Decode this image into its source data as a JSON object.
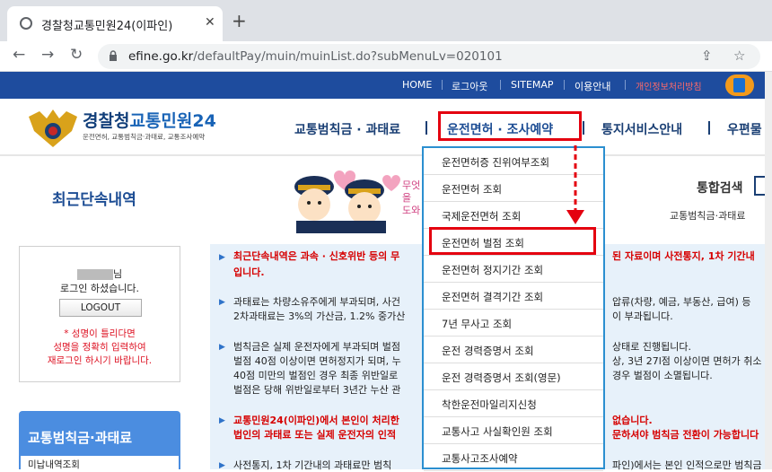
{
  "browser": {
    "tab_title": "경찰청교통민원24(이파인)",
    "url_host": "efine.go.kr",
    "url_path": "/defaultPay/muin/muinList.do?subMenuLv=020101"
  },
  "topbar": {
    "items": [
      "HOME",
      "로그아웃",
      "SITEMAP",
      "이용안내",
      "개인정보처리방침"
    ]
  },
  "header": {
    "logo_a": "경찰청",
    "logo_b": "교통민원24",
    "logo_sub": "운전면허, 교통범칙금·과태료, 교통조사예약",
    "gnb": [
      "교통범칙금 · 과태료",
      "운전면허 · 조사예약",
      "통지서비스안내",
      "우편물"
    ]
  },
  "page": {
    "title": "최근단속내역",
    "search_label": "통합검색",
    "search_sub": "교통범칙금·과태료",
    "mascot_text": "무엇을 도와"
  },
  "login": {
    "user_suffix": "님",
    "status": "로그인 하셨습니다.",
    "logout_label": "LOGOUT",
    "warning": [
      "* 성명이 틀리다면",
      "성명을 정확히 입력하여",
      "재로그인 하시기 바랍니다."
    ]
  },
  "left_menu": {
    "title": "교통범칙금·과태료",
    "sub_item": "미납내역조회"
  },
  "notice": {
    "lines": [
      {
        "text": "최근단속내역은 과속 · 신호위반 등의 무",
        "red": true
      },
      {
        "text": "입니다.",
        "red": true
      },
      {
        "text": "과태료는 차량소유주에게 부과되며, 사건",
        "red": false
      },
      {
        "text": "2차과태료는 3%의 가산금, 1.2% 중가산",
        "red": false
      },
      {
        "text": "범칙금은 실제 운전자에게 부과되며 벌점",
        "red": false
      },
      {
        "text": "벌점 40점 이상이면 면허정지가 되며, 누",
        "red": false
      },
      {
        "text": "40점 미만의 벌점인 경우 최종 위반일로",
        "red": false
      },
      {
        "text": "벌점은 당해 위반일로부터 3년간 누산 관",
        "red": false
      },
      {
        "text": "교통민원24(이파인)에서 본인이 처리한",
        "red": true
      },
      {
        "text": "법인의 과태료 또는 실제 운전자의 인적",
        "red": true
      },
      {
        "text": "사전통지, 1차 기간내의 과태료만 범칙",
        "red": false
      }
    ],
    "right_lines": [
      {
        "text": "된 자료이며 사전통지, 1차 기간내",
        "red": true
      },
      {
        "text": "압류(차량, 예금, 부동산, 급여) 등",
        "red": false
      },
      {
        "text": "이 부과됩니다.",
        "red": false
      },
      {
        "text": "상태로 진행됩니다.",
        "red": false
      },
      {
        "text": "상, 3년 27l점 이상이면 면허가 취소",
        "red": false
      },
      {
        "text": "경우 벌점이 소멸됩니다.",
        "red": false
      },
      {
        "text": "없습니다.",
        "red": true
      },
      {
        "text": "문하셔야 범칙금 전환이 가능합니다",
        "red": true
      },
      {
        "text": "파인)에서는 본인 인적으로만 범칙금",
        "red": false
      }
    ]
  },
  "dropdown": {
    "items": [
      "운전면허증 진위여부조회",
      "운전면허 조회",
      "국제운전면허 조회",
      "운전면허 벌점 조회",
      "운전면허 정지기간 조회",
      "운전면허 결격기간 조회",
      "7년 무사고 조회",
      "운전 경력증명서 조회",
      "운전 경력증명서 조회(영문)",
      "착한운전마일리지신청",
      "교통사고 사실확인원 조회",
      "교통사고조사예약"
    ],
    "highlighted": "운전면허 벌점 조회"
  },
  "colors": {
    "topbar": "#1e4c9e",
    "accent_red": "#e4000f",
    "dropdown_border": "#2b8fd0",
    "notice_bg": "#e7f1fa"
  }
}
